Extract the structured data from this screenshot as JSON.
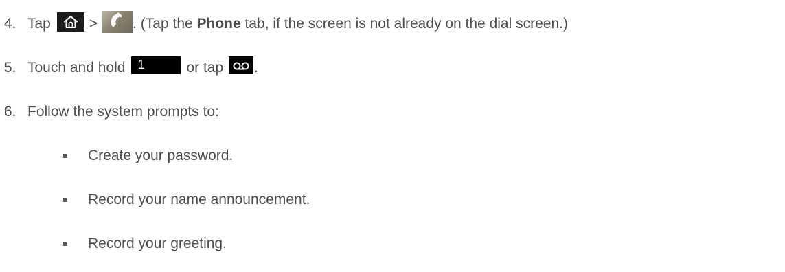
{
  "steps": [
    {
      "number": "4.",
      "text_a": "Tap",
      "text_b": ">",
      "text_c": ". (Tap the ",
      "bold": "Phone",
      "text_d": " tab, if the screen is not already on the dial screen.)"
    },
    {
      "number": "5.",
      "text_a": "Touch and hold",
      "key_label": "1",
      "text_b": "or tap",
      "text_c": "."
    },
    {
      "number": "6.",
      "text_a": "Follow the system prompts to:"
    }
  ],
  "bullets": [
    "Create your password.",
    "Record your name announcement.",
    "Record your greeting."
  ],
  "icons": {
    "home": "home-icon",
    "phone": "phone-icon",
    "key": "dialpad-key-1",
    "voicemail": "voicemail-icon"
  }
}
